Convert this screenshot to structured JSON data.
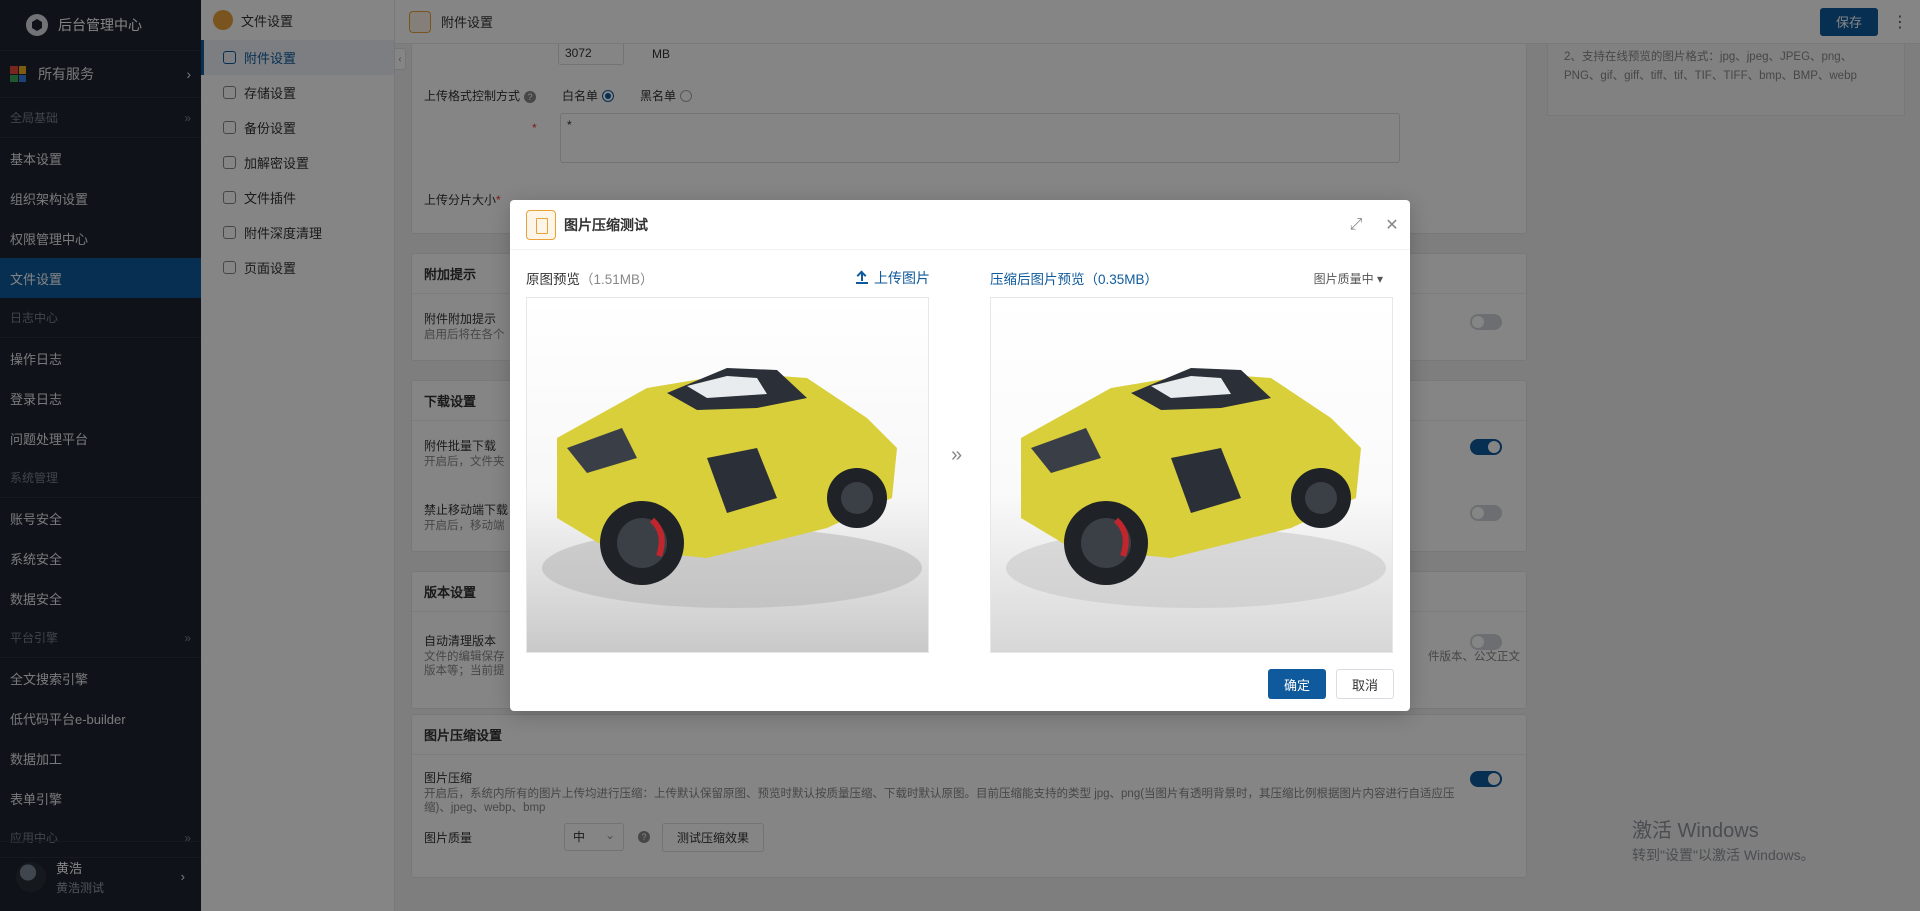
{
  "app": {
    "title": "后台管理中心"
  },
  "sidebar": {
    "all_services": "所有服务",
    "sections": [
      {
        "group": "全局基础",
        "items": [
          "基本设置",
          "组织架构设置",
          "权限管理中心",
          "文件设置"
        ]
      },
      {
        "group": "日志中心",
        "items": [
          "操作日志",
          "登录日志",
          "问题处理平台"
        ]
      },
      {
        "group": "系统管理",
        "items": [
          "账号安全",
          "系统安全",
          "数据安全"
        ]
      },
      {
        "group": "平台引擎",
        "items": [
          "全文搜索引擎",
          "低代码平台e-builder",
          "数据加工",
          "表单引擎"
        ]
      },
      {
        "group": "应用中心",
        "items": []
      }
    ],
    "active_item": "文件设置",
    "user": {
      "name": "黄浩",
      "subtitle": "黄浩测试"
    }
  },
  "submenu": {
    "header": "文件设置",
    "items": [
      "附件设置",
      "存储设置",
      "备份设置",
      "加解密设置",
      "文件插件",
      "附件深度清理",
      "页面设置"
    ],
    "active_item": "附件设置"
  },
  "topbar": {
    "title": "附件设置",
    "save_label": "保存"
  },
  "content": {
    "upload_limit_value": "3072",
    "upload_limit_unit": "MB",
    "format_mode_label": "上传格式控制方式",
    "whitelist_label": "白名单",
    "blacklist_label": "黑名单",
    "format_textarea_value": "*",
    "chunk_size_label": "上传分片大小",
    "help_lines": [
      "2、支持在线预览的图片格式：jpg、jpeg、JPEG、png、",
      "PNG、gif、giff、tiff、tif、TIF、TIFF、bmp、BMP、webp"
    ],
    "extra_tip": {
      "title": "附加提示",
      "row_label": "附件附加提示",
      "row_desc": "启用后将在各个"
    },
    "download": {
      "title": "下载设置",
      "batch_label": "附件批量下载",
      "batch_desc": "开启后，文件夹",
      "mobile_label": "禁止移动端下载",
      "mobile_desc": "开启后，移动端"
    },
    "version": {
      "title": "版本设置",
      "auto_clean_label": "自动清理版本",
      "auto_clean_desc_1": "文件的编辑保存",
      "auto_clean_desc_2": "版本等；当前提",
      "auto_clean_desc_right_1": "件版本、公文正文",
      "auto_clean_desc_right_2": "件版本、公文正文"
    },
    "compress": {
      "title": "图片压缩设置",
      "compress_label": "图片压缩",
      "compress_desc_1": "开启后，系统内所有的图片上传均进行压缩：上传默认保留原图、预览时默认按质量压缩、下载时默认原图。目前压缩能支持的类型 jpg、png(当图片有透明背景时，其压缩比例根据图片内容进行自适应压",
      "compress_desc_2": "缩)、jpeg、webp、bmp",
      "quality_label": "图片质量",
      "quality_value": "中",
      "test_button": "测试压缩效果"
    }
  },
  "watermark": {
    "line1": "激活 Windows",
    "line2": "转到\"设置\"以激活 Windows。"
  },
  "modal": {
    "title": "图片压缩测试",
    "original_label": "原图预览",
    "original_size": "（1.51MB）",
    "upload_label": "上传图片",
    "compressed_label": "压缩后图片预览",
    "compressed_size": "（0.35MB）",
    "quality_dropdown": "图片质量中",
    "confirm_label": "确定",
    "cancel_label": "取消"
  },
  "colors": {
    "primary": "#0f5a9c",
    "sidebar_bg": "#1e2530",
    "accent_orange": "#e8a23a",
    "car_yellow": "#d8cf3a"
  },
  "icons": [
    "logo-icon",
    "grid-icon",
    "chevron-right-icon",
    "double-chevron-right-icon",
    "file-settings-icon",
    "expand-icon",
    "close-icon",
    "upload-icon",
    "caret-down-icon",
    "help-icon",
    "more-icon"
  ]
}
